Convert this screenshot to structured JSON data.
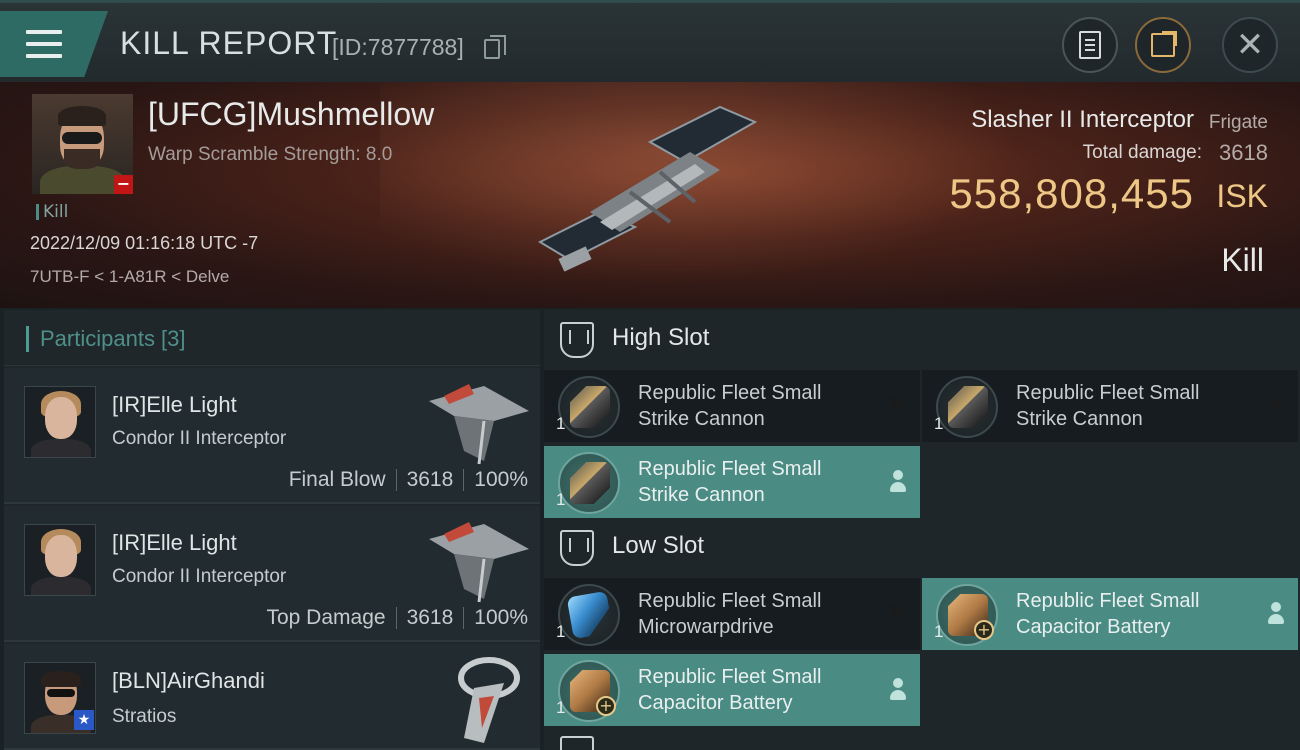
{
  "header": {
    "title": "KILL REPORT",
    "id_text": "[ID:7877788]"
  },
  "victim": {
    "name": "[UFCG]Mushmellow",
    "warp_scramble": "Warp Scramble Strength: 8.0",
    "tag": "Kill",
    "datetime": "2022/12/09 01:16:18 UTC -7",
    "location": "7UTB-F < 1-A81R < Delve",
    "ship_name": "Slasher II Interceptor",
    "ship_class": "Frigate",
    "total_damage_label": "Total damage:",
    "total_damage": "3618",
    "isk_value": "558,808,455",
    "isk_unit": "ISK",
    "result": "Kill"
  },
  "participants": {
    "title": "Participants [3]",
    "rows": [
      {
        "name": "[IR]Elle Light",
        "ship": "Condor II Interceptor",
        "role": "Final Blow",
        "damage": "3618",
        "percent": "100%"
      },
      {
        "name": "[IR]Elle Light",
        "ship": "Condor II Interceptor",
        "role": "Top Damage",
        "damage": "3618",
        "percent": "100%"
      },
      {
        "name": "[BLN]AirGhandi",
        "ship": "Stratios"
      }
    ]
  },
  "slots": {
    "high": {
      "title": "High Slot",
      "items": [
        {
          "line1": "Republic Fleet Small",
          "line2": "Strike Cannon",
          "qty": "1",
          "status": "destroyed",
          "icon": "gun"
        },
        {
          "line1": "Republic Fleet Small",
          "line2": "Strike Cannon",
          "qty": "1",
          "status": "destroyed",
          "icon": "gun"
        },
        {
          "line1": "Republic Fleet Small",
          "line2": "Strike Cannon",
          "qty": "1",
          "status": "fitted",
          "icon": "gun"
        }
      ]
    },
    "low": {
      "title": "Low Slot",
      "items": [
        {
          "line1": "Republic Fleet Small",
          "line2": "Microwarpdrive",
          "qty": "1",
          "status": "destroyed",
          "icon": "mwd"
        },
        {
          "line1": "Republic Fleet Small",
          "line2": "Capacitor Battery",
          "qty": "1",
          "status": "fitted",
          "icon": "cap"
        },
        {
          "line1": "Republic Fleet Small",
          "line2": "Capacitor Battery",
          "qty": "1",
          "status": "fitted",
          "icon": "cap"
        }
      ]
    }
  },
  "colors": {
    "accent": "#4a8c84",
    "isk": "#eec786",
    "alert": "#c21616"
  }
}
